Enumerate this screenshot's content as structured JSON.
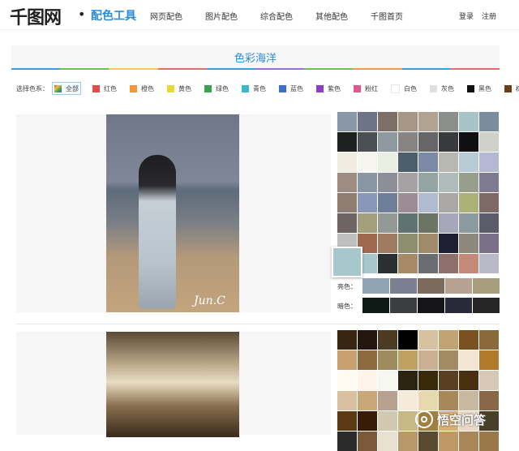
{
  "header": {
    "logo": "千图网",
    "logo_dot": "•",
    "logo_sub": "配色工具",
    "nav": [
      "网页配色",
      "图片配色",
      "综合配色",
      "其他配色",
      "千图首页"
    ],
    "login": "登录",
    "register": "注册"
  },
  "band": {
    "title": "色彩海洋",
    "line_colors": [
      "#3aa0e0",
      "#6fbf5a",
      "#f2c94c",
      "#e86b6b",
      "#3aa0e0",
      "#9b6fd6",
      "#6fbf5a",
      "#f2994a",
      "#3aa0e0",
      "#e86b6b"
    ]
  },
  "filter": {
    "label": "选择色系：",
    "options": [
      {
        "label": "全部",
        "color": "multi",
        "active": true
      },
      {
        "label": "红色",
        "color": "#e04b4b"
      },
      {
        "label": "橙色",
        "color": "#f29a3a"
      },
      {
        "label": "黄色",
        "color": "#e7d93a"
      },
      {
        "label": "绿色",
        "color": "#3aa24c"
      },
      {
        "label": "青色",
        "color": "#3bb8c7"
      },
      {
        "label": "蓝色",
        "color": "#3a70c9"
      },
      {
        "label": "紫色",
        "color": "#8b3fc1"
      },
      {
        "label": "粉红",
        "color": "#e0578d"
      },
      {
        "label": "白色",
        "color": "#ffffff"
      },
      {
        "label": "灰色",
        "color": "#e0e0e0"
      },
      {
        "label": "黑色",
        "color": "#111111"
      },
      {
        "label": "棕色",
        "color": "#6b3f1a"
      }
    ]
  },
  "section1": {
    "signature": "Jun.C",
    "palette": [
      "#8a97a8",
      "#6d7388",
      "#7d6e66",
      "#a69686",
      "#b2a291",
      "#8b8f8c",
      "#a8c3c6",
      "#7a8c9e",
      "#1d2220",
      "#4b5055",
      "#8f9aa0",
      "#868583",
      "#666668",
      "#393a3c",
      "#101012",
      "#cfd0c8",
      "#f0ece0",
      "#f7f6ee",
      "#e9efe3",
      "#4b5e6b",
      "#7c8aa6",
      "#b7b8b0",
      "#b9cad7",
      "#b5b8d2",
      "#9e8c82",
      "#8997a5",
      "#8d8e98",
      "#a4a2a3",
      "#93a4a2",
      "#aebbb9",
      "#979e8c",
      "#7d7a91",
      "#8e7d70",
      "#8997b8",
      "#6f7f9a",
      "#9d8c94",
      "#b1bbd0",
      "#a9a8a6",
      "#aab279",
      "#7d6a66",
      "#6e6464",
      "#a4a07e",
      "#939994",
      "#5f7372",
      "#6c7564",
      "#a5a6b9",
      "#8a9a9e",
      "#5b5b6b",
      "#bfbfbf",
      "#a0684f",
      "#a17a64",
      "#8b8f6e",
      "#a08a6c",
      "#1e1f30",
      "#8c887e",
      "#7a6f86",
      "#a6c8cc",
      "#a6c8cc",
      "#2a3030",
      "#a88a68",
      "#6a6e72",
      "#8f6e6b",
      "#c48a78",
      "#b9b9c8"
    ],
    "big_swatch": "#a6c8cc",
    "bright_label": "亮色：",
    "bright": [
      "#8fa3b4",
      "#7b7f94",
      "#7c6a5c",
      "#b7a191",
      "#a79c7c"
    ],
    "dark_label": "暗色：",
    "dark": [
      "#0f1a16",
      "#3a3e40",
      "#151517",
      "#282a3a",
      "#262626"
    ]
  },
  "section2": {
    "palette": [
      "#3a2512",
      "#24170f",
      "#4a3b22",
      "#000000",
      "#d6c2a0",
      "#c0a472",
      "#7a5220",
      "#8a6a3a",
      "#c9a070",
      "#8c6a3e",
      "#a08a60",
      "#bfa060",
      "#c8b090",
      "#a08c60",
      "#f2e6d2",
      "#b07a2a",
      "#fffaf2",
      "#fff4ea",
      "#f6f8f0",
      "#2a2410",
      "#3a2a0c",
      "#5a4020",
      "#4a3010",
      "#d8c8b8",
      "#d8c0a0",
      "#c8a878",
      "#b8a090",
      "#f4ecd8",
      "#e8d8b0",
      "#a88858",
      "#c8b8a0",
      "#886848",
      "#5a3a12",
      "#3a1a08",
      "#d0c8b0",
      "#c8b888",
      "#a08040",
      "#d8b070",
      "#e8d8c8",
      "#484028",
      "#2a2a2a",
      "#7a5a3a",
      "#e8e0d0",
      "#b89868",
      "#5a4a30",
      "#c09868",
      "#a88858",
      "#9a7848"
    ]
  },
  "watermark": "悟空问答"
}
